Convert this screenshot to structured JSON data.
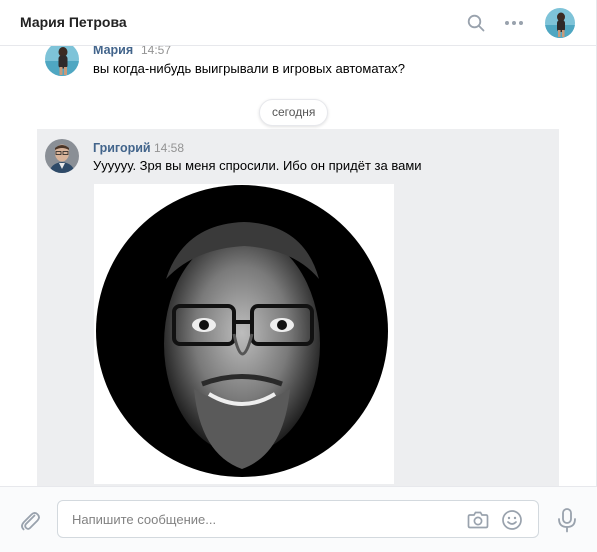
{
  "header": {
    "title": "Мария Петрова",
    "search_icon": "search-icon",
    "more_icon": "more-icon"
  },
  "date_separator": "сегодня",
  "messages": [
    {
      "author": "Мария",
      "time": "14:57",
      "text": "вы когда-нибудь выигрывали в игровых автоматах?"
    },
    {
      "author": "Григорий",
      "time": "14:58",
      "text": "Уууууу. Зря вы меня спросили. Ибо он придёт за вами",
      "attachment": "photo"
    }
  ],
  "composer": {
    "placeholder": "Напишите сообщение...",
    "value": "",
    "icons": [
      "paperclip-icon",
      "camera-icon",
      "smile-icon",
      "microphone-icon"
    ]
  },
  "colors": {
    "accent": "#42648b",
    "selected_bg": "#edeef0",
    "icon": "#99a2ad"
  }
}
